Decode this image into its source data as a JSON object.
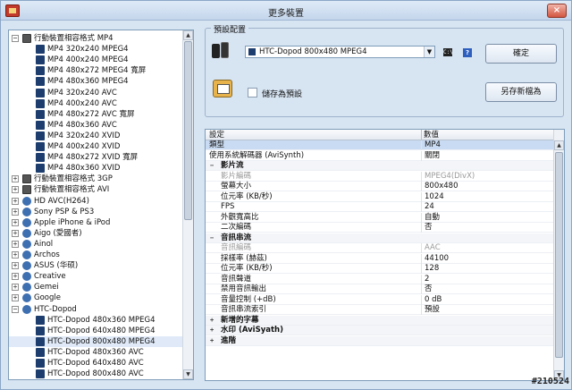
{
  "window": {
    "title": "更多裝置"
  },
  "tree": {
    "items": [
      {
        "label": "行動裝置相容格式 MP4",
        "level": 0,
        "expander": "−",
        "icon": "folder-device"
      },
      {
        "label": "MP4 320x240 MPEG4",
        "level": 1,
        "icon": "mp4"
      },
      {
        "label": "MP4 400x240 MPEG4",
        "level": 1,
        "icon": "mp4"
      },
      {
        "label": "MP4 480x272 MPEG4 寬屏",
        "level": 1,
        "icon": "mp4"
      },
      {
        "label": "MP4 480x360 MPEG4",
        "level": 1,
        "icon": "mp4"
      },
      {
        "label": "MP4 320x240 AVC",
        "level": 1,
        "icon": "mp4"
      },
      {
        "label": "MP4 400x240 AVC",
        "level": 1,
        "icon": "mp4"
      },
      {
        "label": "MP4 480x272 AVC 寬屏",
        "level": 1,
        "icon": "mp4"
      },
      {
        "label": "MP4 480x360 AVC",
        "level": 1,
        "icon": "mp4"
      },
      {
        "label": "MP4 320x240 XVID",
        "level": 1,
        "icon": "mp4"
      },
      {
        "label": "MP4 400x240 XVID",
        "level": 1,
        "icon": "mp4"
      },
      {
        "label": "MP4 480x272 XVID 寬屏",
        "level": 1,
        "icon": "mp4"
      },
      {
        "label": "MP4 480x360 XVID",
        "level": 1,
        "icon": "mp4"
      },
      {
        "label": "行動裝置相容格式 3GP",
        "level": 0,
        "expander": "+",
        "icon": "folder-device"
      },
      {
        "label": "行動裝置相容格式 AVI",
        "level": 0,
        "expander": "+",
        "icon": "folder-device"
      },
      {
        "label": "HD AVC(H264)",
        "level": 0,
        "expander": "+",
        "icon": "brand"
      },
      {
        "label": "Sony PSP & PS3",
        "level": 0,
        "expander": "+",
        "icon": "brand"
      },
      {
        "label": "Apple iPhone & iPod",
        "level": 0,
        "expander": "+",
        "icon": "brand"
      },
      {
        "label": "Aigo (愛國者)",
        "level": 0,
        "expander": "+",
        "icon": "brand"
      },
      {
        "label": "Ainol",
        "level": 0,
        "expander": "+",
        "icon": "brand"
      },
      {
        "label": "Archos",
        "level": 0,
        "expander": "+",
        "icon": "brand"
      },
      {
        "label": "ASUS (华硕)",
        "level": 0,
        "expander": "+",
        "icon": "brand"
      },
      {
        "label": "Creative",
        "level": 0,
        "expander": "+",
        "icon": "brand"
      },
      {
        "label": "Gemei",
        "level": 0,
        "expander": "+",
        "icon": "brand"
      },
      {
        "label": "Google",
        "level": 0,
        "expander": "+",
        "icon": "brand"
      },
      {
        "label": "HTC-Dopod",
        "level": 0,
        "expander": "−",
        "icon": "brand"
      },
      {
        "label": "HTC-Dopod 480x360 MPEG4",
        "level": 1,
        "icon": "mp4"
      },
      {
        "label": "HTC-Dopod 640x480 MPEG4",
        "level": 1,
        "icon": "mp4"
      },
      {
        "label": "HTC-Dopod 800x480 MPEG4",
        "level": 1,
        "icon": "mp4",
        "selected": true
      },
      {
        "label": "HTC-Dopod 480x360 AVC",
        "level": 1,
        "icon": "mp4"
      },
      {
        "label": "HTC-Dopod 640x480 AVC",
        "level": 1,
        "icon": "mp4"
      },
      {
        "label": "HTC-Dopod 800x480 AVC",
        "level": 1,
        "icon": "mp4"
      }
    ]
  },
  "preset": {
    "group_label": "預設配置",
    "selected": "HTC-Dopod 800x480 MPEG4",
    "cmd_icon_text": "C:\\",
    "help_icon_text": "?",
    "ok_label": "確定",
    "save_as_label": "另存新檔為",
    "save_checkbox_label": "儲存為預設",
    "save_checked": false
  },
  "grid": {
    "col_setting": "設定",
    "col_value": "數值",
    "rows": [
      {
        "key": "類型",
        "value": "MP4",
        "kind": "top",
        "highlight": true
      },
      {
        "key": "使用系統解碼器 (AviSynth)",
        "value": "關閉",
        "kind": "top"
      },
      {
        "key": "影片流",
        "value": "",
        "kind": "cat",
        "expander": "−"
      },
      {
        "key": "影片編碼",
        "value": "MPEG4(DivX)",
        "kind": "sub",
        "disabled": true
      },
      {
        "key": "螢幕大小",
        "value": "800x480",
        "kind": "sub"
      },
      {
        "key": "位元率 (KB/秒)",
        "value": "1024",
        "kind": "sub"
      },
      {
        "key": "FPS",
        "value": "24",
        "kind": "sub"
      },
      {
        "key": "外觀寬高比",
        "value": "自動",
        "kind": "sub"
      },
      {
        "key": "二次編碼",
        "value": "否",
        "kind": "sub"
      },
      {
        "key": "音訊串流",
        "value": "",
        "kind": "cat",
        "expander": "−"
      },
      {
        "key": "音訊編碼",
        "value": "AAC",
        "kind": "sub",
        "disabled": true
      },
      {
        "key": "採樣率 (赫茲)",
        "value": "44100",
        "kind": "sub"
      },
      {
        "key": "位元率 (KB/秒)",
        "value": "128",
        "kind": "sub"
      },
      {
        "key": "音訊聲道",
        "value": "2",
        "kind": "sub"
      },
      {
        "key": "禁用音訊輸出",
        "value": "否",
        "kind": "sub"
      },
      {
        "key": "音量控制 (+dB)",
        "value": "0 dB",
        "kind": "sub"
      },
      {
        "key": "音訊串流索引",
        "value": "預設",
        "kind": "sub"
      },
      {
        "key": "新增的字幕",
        "value": "",
        "kind": "cat",
        "expander": "+"
      },
      {
        "key": "水印 (AviSyath)",
        "value": "",
        "kind": "cat",
        "expander": "+"
      },
      {
        "key": "進階",
        "value": "",
        "kind": "cat",
        "expander": "+"
      }
    ]
  },
  "watermark": "#210524",
  "colors": {
    "window_bg": "#d7e4f2",
    "selected_row": "#c9dbf2"
  }
}
